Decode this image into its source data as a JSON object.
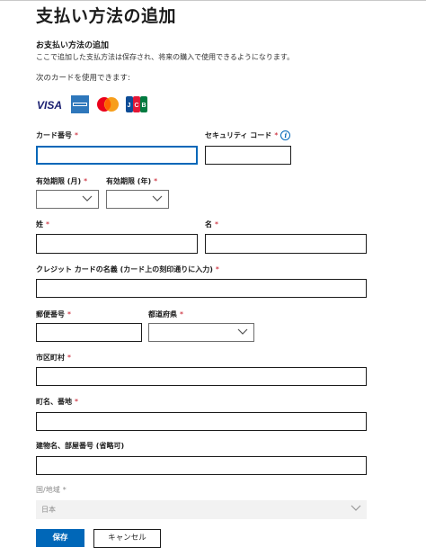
{
  "page": {
    "title": "支払い方法の追加",
    "subtitle": "お支払い方法の追加",
    "description": "ここで追加した支払方法は保存され、将来の購入で使用できるようになります。",
    "accepted_cards_label": "次のカードを使用できます:"
  },
  "cards": [
    {
      "name": "VISA",
      "icon": "visa-icon",
      "color": "#1a1f71"
    },
    {
      "name": "AMERICAN EXPRESS",
      "icon": "amex-icon",
      "color": "#2e77bb"
    },
    {
      "name": "Mastercard",
      "icon": "mastercard-icon",
      "color": "#eb001b"
    },
    {
      "name": "JCB",
      "icon": "jcb-icon",
      "color": "#0e4c96"
    }
  ],
  "form": {
    "required_mark": "*",
    "card_number_label": "カード番号",
    "security_code_label": "セキュリティ コード",
    "exp_month_label": "有効期限 (月)",
    "exp_year_label": "有効期限 (年)",
    "last_name_label": "姓",
    "first_name_label": "名",
    "card_holder_label": "クレジット カードの名義 (カード上の刻印通りに入力)",
    "postal_code_label": "郵便番号",
    "prefecture_label": "都道府県",
    "city_label": "市区町村",
    "street_label": "町名、番地",
    "building_label": "建物名、部屋番号 (省略可)",
    "country_label": "国/地域",
    "country_value": "日本"
  },
  "buttons": {
    "save": "保存",
    "cancel": "キャンセル"
  },
  "colors": {
    "accent": "#0067b8",
    "required": "#c50f1f",
    "disabled_bg": "#f2f2f2"
  }
}
